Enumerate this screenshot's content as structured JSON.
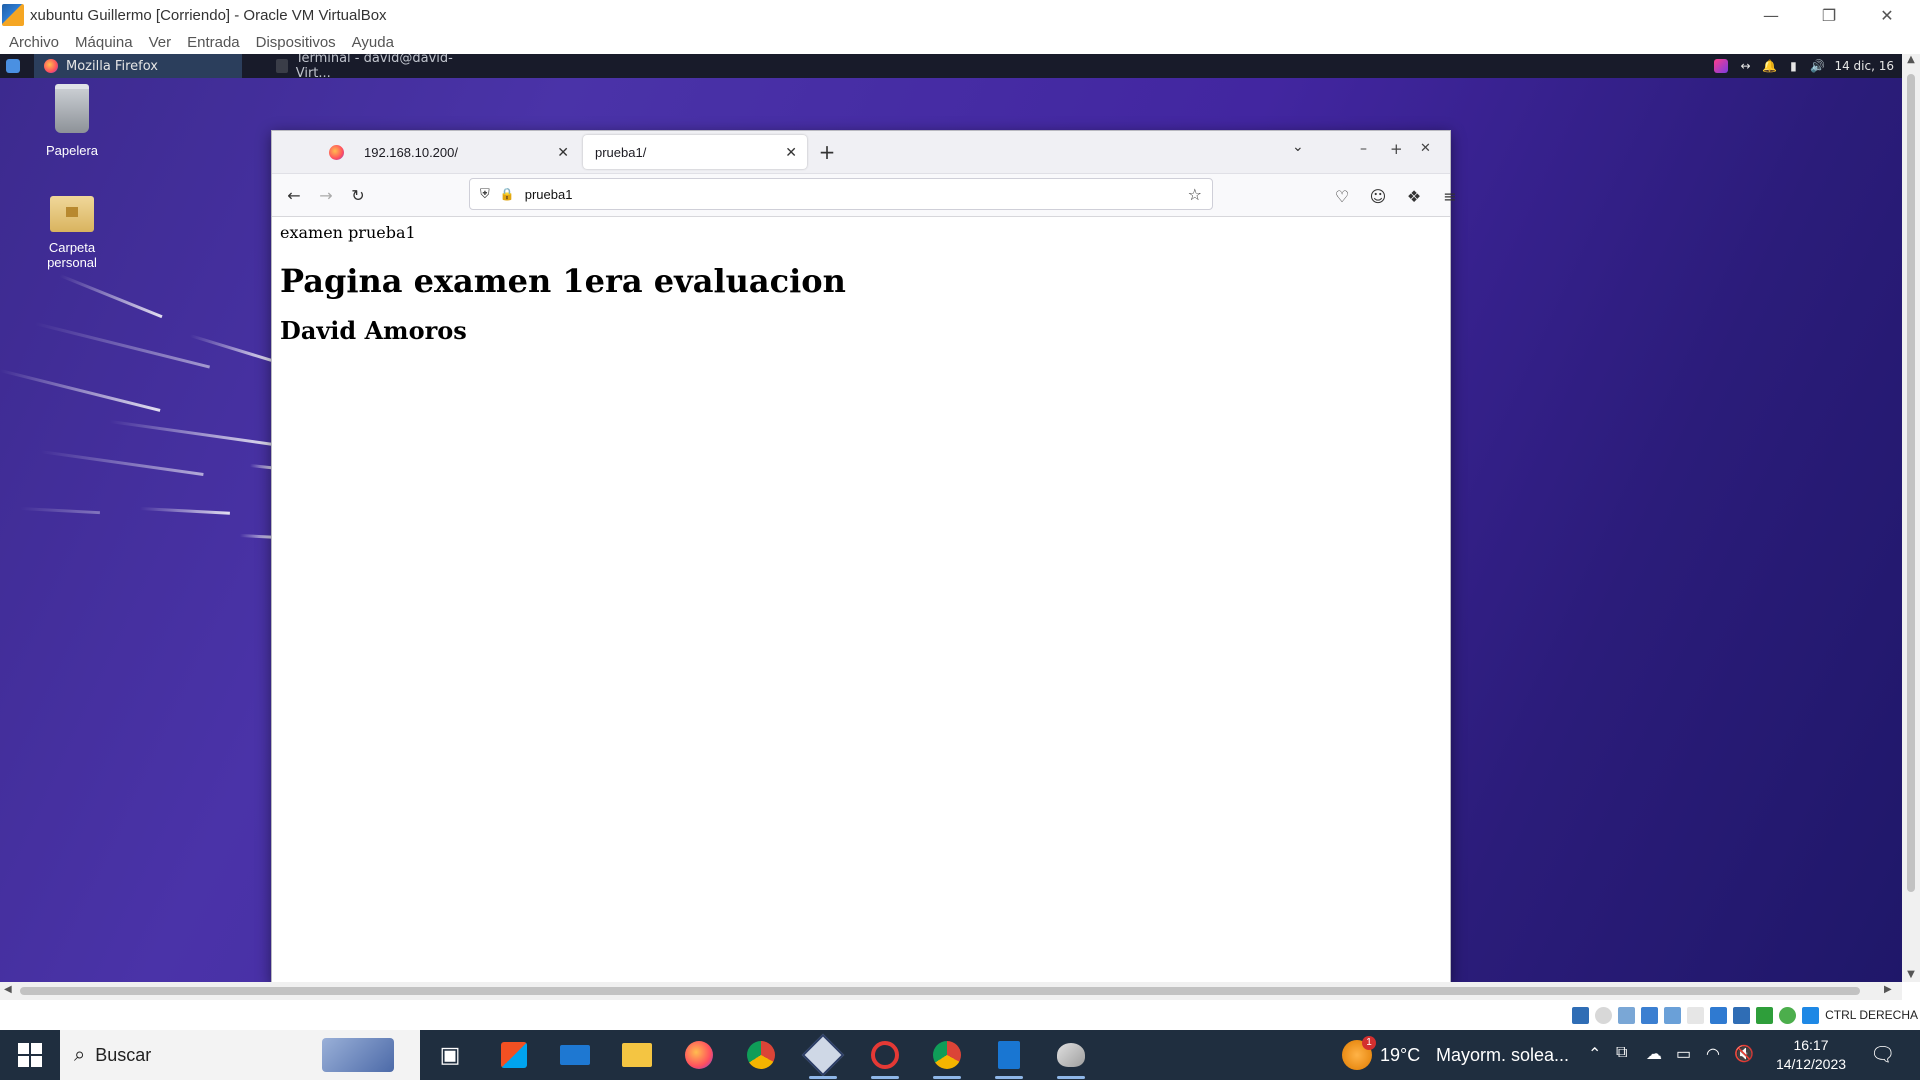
{
  "vbox": {
    "title": "xubuntu Guillermo [Corriendo] - Oracle VM VirtualBox",
    "menu": [
      "Archivo",
      "Máquina",
      "Ver",
      "Entrada",
      "Dispositivos",
      "Ayuda"
    ],
    "host_key": "CTRL DERECHA"
  },
  "xfce_panel": {
    "tasks": [
      {
        "label": "Mozilla Firefox"
      },
      {
        "label": "Terminal - david@david-Virt..."
      }
    ],
    "clock": "14 dic, 16"
  },
  "desktop": {
    "icons": [
      {
        "label": "Papelera",
        "icon": "trash-icon"
      },
      {
        "label": "Carpeta personal",
        "icon": "home-folder-icon"
      }
    ]
  },
  "firefox": {
    "tabs": [
      {
        "label": "192.168.10.200/",
        "active": false
      },
      {
        "label": "prueba1/",
        "active": true
      }
    ],
    "url": "prueba1",
    "page": {
      "text": "examen prueba1",
      "h1": "Pagina examen 1era evaluacion",
      "h2": "David Amoros"
    }
  },
  "taskbar": {
    "search_placeholder": "Buscar",
    "weather": {
      "temp": "19°C",
      "desc": "Mayorm. solea...",
      "badge": "1"
    },
    "time": "16:17",
    "date": "14/12/2023"
  }
}
